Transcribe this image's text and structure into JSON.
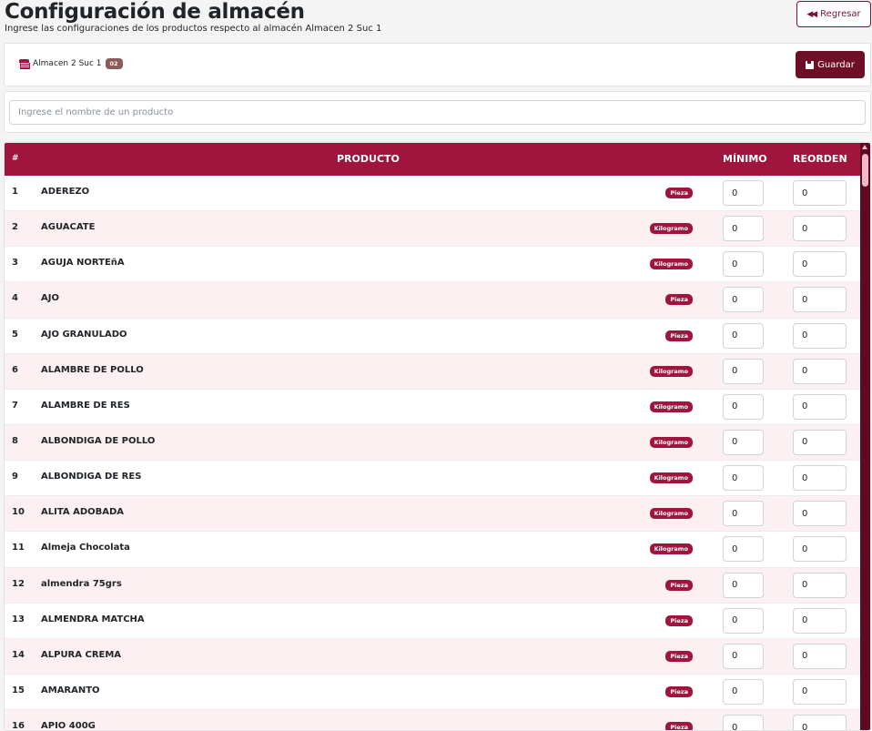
{
  "header": {
    "title": "Configuración de almacén",
    "subtitle": "Ingrese las configuraciones de los productos respecto al almacén Almacen 2 Suc 1",
    "back_label": "Regresar"
  },
  "warehouse": {
    "name": "Almacen 2 Suc 1",
    "badge": "02",
    "save_label": "Guardar"
  },
  "search": {
    "placeholder": "Ingrese el nombre de un producto"
  },
  "table": {
    "headers": {
      "num": "#",
      "product": "PRODUCTO",
      "min": "MÍNIMO",
      "reorder": "REORDEN"
    },
    "rows": [
      {
        "num": "1",
        "name": "ADEREZO",
        "unit": "Pieza",
        "min": "0",
        "reorder": "0"
      },
      {
        "num": "2",
        "name": "AGUACATE",
        "unit": "Kilogramo",
        "min": "0",
        "reorder": "0"
      },
      {
        "num": "3",
        "name": "AGUJA NORTEñA",
        "unit": "Kilogramo",
        "min": "0",
        "reorder": "0"
      },
      {
        "num": "4",
        "name": "AJO",
        "unit": "Pieza",
        "min": "0",
        "reorder": "0"
      },
      {
        "num": "5",
        "name": "AJO GRANULADO",
        "unit": "Pieza",
        "min": "0",
        "reorder": "0"
      },
      {
        "num": "6",
        "name": "ALAMBRE DE POLLO",
        "unit": "Kilogramo",
        "min": "0",
        "reorder": "0"
      },
      {
        "num": "7",
        "name": "ALAMBRE DE RES",
        "unit": "Kilogramo",
        "min": "0",
        "reorder": "0"
      },
      {
        "num": "8",
        "name": "ALBONDIGA DE POLLO",
        "unit": "Kilogramo",
        "min": "0",
        "reorder": "0"
      },
      {
        "num": "9",
        "name": "ALBONDIGA DE RES",
        "unit": "Kilogramo",
        "min": "0",
        "reorder": "0"
      },
      {
        "num": "10",
        "name": "ALITA ADOBADA",
        "unit": "Kilogramo",
        "min": "0",
        "reorder": "0"
      },
      {
        "num": "11",
        "name": "Almeja Chocolata",
        "unit": "Kilogramo",
        "min": "0",
        "reorder": "0"
      },
      {
        "num": "12",
        "name": "almendra 75grs",
        "unit": "Pieza",
        "min": "0",
        "reorder": "0"
      },
      {
        "num": "13",
        "name": "ALMENDRA MATCHA",
        "unit": "Pieza",
        "min": "0",
        "reorder": "0"
      },
      {
        "num": "14",
        "name": "ALPURA CREMA",
        "unit": "Pieza",
        "min": "0",
        "reorder": "0"
      },
      {
        "num": "15",
        "name": "AMARANTO",
        "unit": "Pieza",
        "min": "0",
        "reorder": "0"
      },
      {
        "num": "16",
        "name": "APIO 400G",
        "unit": "Pieza",
        "min": "0",
        "reorder": "0"
      }
    ]
  },
  "colors": {
    "primary": "#a0153e",
    "dark": "#6d0f27",
    "row_alt": "#fdf0f2"
  }
}
